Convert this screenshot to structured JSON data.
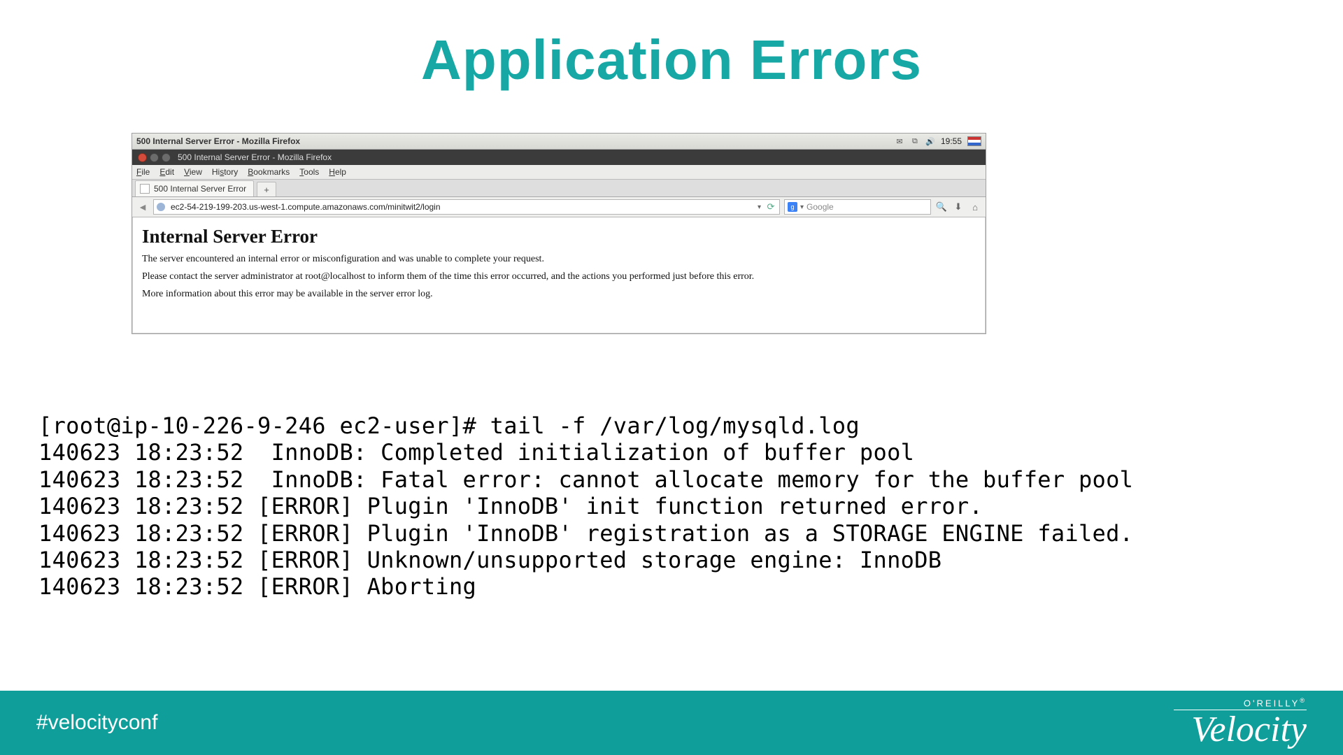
{
  "slide": {
    "title": "Application Errors"
  },
  "browser": {
    "top_title": "500 Internal Server Error - Mozilla Firefox",
    "tray": {
      "time": "19:55"
    },
    "title2": "500 Internal Server Error - Mozilla Firefox",
    "menu": {
      "file": "File",
      "edit": "Edit",
      "view": "View",
      "history": "History",
      "bookmarks": "Bookmarks",
      "tools": "Tools",
      "help": "Help"
    },
    "tab_label": "500 Internal Server Error",
    "new_tab_glyph": "+",
    "back_glyph": "◄",
    "url": "ec2-54-219-199-203.us-west-1.compute.amazonaws.com/minitwit2/login",
    "url_dropdown_glyph": "▾",
    "refresh_glyph": "⟳",
    "search": {
      "engine_glyph": "g",
      "dropdown_glyph": "▾",
      "placeholder": "Google"
    },
    "magnify_glyph": "🔍",
    "download_glyph": "⬇",
    "home_glyph": "⌂"
  },
  "page": {
    "h1": "Internal Server Error",
    "p1": "The server encountered an internal error or misconfiguration and was unable to complete your request.",
    "p2": "Please contact the server administrator at root@localhost to inform them of the time this error occurred, and the actions you performed just before this error.",
    "p3": "More information about this error may be available in the server error log."
  },
  "terminal": {
    "prompt": "[root@ip-10-226-9-246 ec2-user]# tail -f /var/log/mysqld.log",
    "lines": [
      "140623 18:23:52  InnoDB: Completed initialization of buffer pool",
      "140623 18:23:52  InnoDB: Fatal error: cannot allocate memory for the buffer pool",
      "140623 18:23:52 [ERROR] Plugin 'InnoDB' init function returned error.",
      "140623 18:23:52 [ERROR] Plugin 'InnoDB' registration as a STORAGE ENGINE failed.",
      "140623 18:23:52 [ERROR] Unknown/unsupported storage engine: InnoDB",
      "140623 18:23:52 [ERROR] Aborting"
    ]
  },
  "footer": {
    "hashtag": "#velocityconf",
    "oreilly": "O'REILLY",
    "reg": "®",
    "brand": "Velocity"
  }
}
